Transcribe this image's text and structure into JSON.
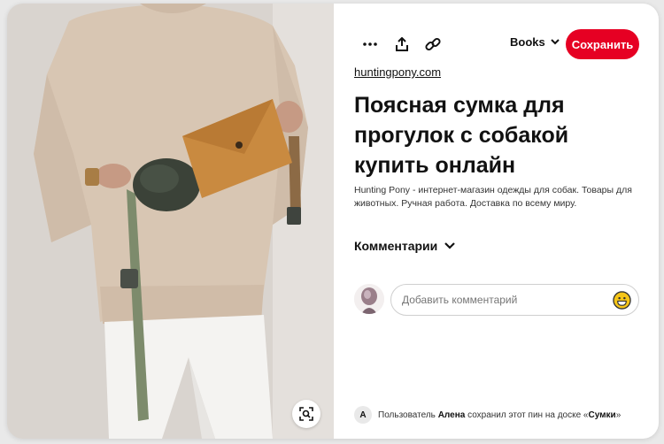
{
  "toolbar": {
    "more_icon": "more-dots-icon",
    "share_icon": "share-upload-icon",
    "link_icon": "link-icon",
    "board_name": "Books",
    "save_label": "Сохранить"
  },
  "pin": {
    "source": "huntingpony.com",
    "title": "Поясная сумка для прогулок с собакой купить онлайн",
    "description": "Hunting Pony - интернет-магазин одежды для собак. Товары для животных. Ручная работа. Доставка по всему миру."
  },
  "comments": {
    "heading": "Комментарии",
    "placeholder": "Добавить комментарий"
  },
  "saved_by": {
    "initial": "А",
    "prefix": "Пользователь",
    "user": "Алена",
    "middle": "сохранил этот пин на доске «",
    "board": "Сумки",
    "suffix": "»"
  },
  "colors": {
    "accent": "#e60023"
  }
}
